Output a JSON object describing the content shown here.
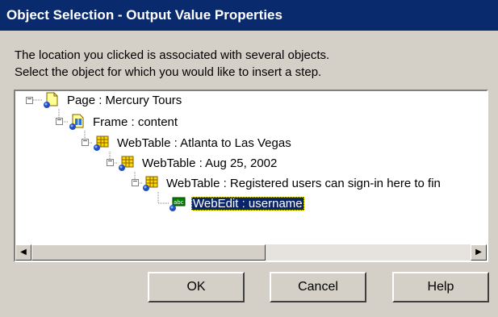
{
  "window": {
    "title": "Object Selection - Output Value Properties"
  },
  "description": {
    "line1": "The location you clicked is associated with several objects.",
    "line2": "Select the object for which you would like to insert a step."
  },
  "tree": {
    "nodes": [
      {
        "label": "Page : Mercury Tours",
        "icon": "page-icon",
        "expander": "minus"
      },
      {
        "label": "Frame : content",
        "icon": "frame-icon",
        "expander": "minus"
      },
      {
        "label": "WebTable : Atlanta to Las Vegas",
        "icon": "webtable-icon",
        "expander": "minus"
      },
      {
        "label": "WebTable : Aug 25, 2002",
        "icon": "webtable-icon",
        "expander": "minus"
      },
      {
        "label": "WebTable : Registered users can sign-in here to fin",
        "icon": "webtable-icon",
        "expander": "minus"
      },
      {
        "label": "WebEdit : username",
        "icon": "webedit-icon",
        "selected": true
      }
    ]
  },
  "buttons": {
    "ok": "OK",
    "cancel": "Cancel",
    "help": "Help"
  },
  "colors": {
    "title_bar": "#0a2a6e",
    "selection": "#0a246a",
    "face": "#d4d0c8"
  }
}
